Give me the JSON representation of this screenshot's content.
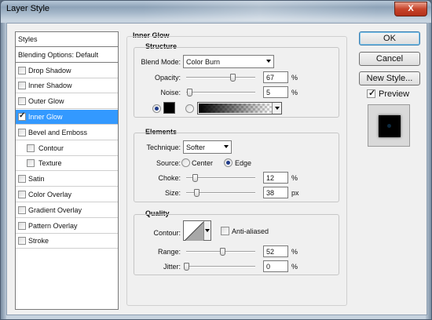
{
  "window": {
    "title": "Layer Style",
    "close_label": "X"
  },
  "sidebar": {
    "items": [
      {
        "label": "Styles",
        "header": true
      },
      {
        "label": "Blending Options: Default",
        "header": true
      },
      {
        "label": "Drop Shadow",
        "checked": false
      },
      {
        "label": "Inner Shadow",
        "checked": false
      },
      {
        "label": "Outer Glow",
        "checked": false
      },
      {
        "label": "Inner Glow",
        "checked": true,
        "selected": true
      },
      {
        "label": "Bevel and Emboss",
        "checked": false
      },
      {
        "label": "Contour",
        "checked": false,
        "sub": true
      },
      {
        "label": "Texture",
        "checked": false,
        "sub": true
      },
      {
        "label": "Satin",
        "checked": false
      },
      {
        "label": "Color Overlay",
        "checked": false
      },
      {
        "label": "Gradient Overlay",
        "checked": false
      },
      {
        "label": "Pattern Overlay",
        "checked": false
      },
      {
        "label": "Stroke",
        "checked": false
      }
    ]
  },
  "panel": {
    "title": "Inner Glow",
    "structure": {
      "title": "Structure",
      "blend_mode_label": "Blend Mode:",
      "blend_mode_value": "Color Burn",
      "opacity_label": "Opacity:",
      "opacity_value": "67",
      "opacity_unit": "%",
      "opacity_level": 0.67,
      "noise_label": "Noise:",
      "noise_value": "5",
      "noise_unit": "%",
      "noise_level": 0.05,
      "fill_mode": "color",
      "glow_color": "#000000"
    },
    "elements": {
      "title": "Elements",
      "technique_label": "Technique:",
      "technique_value": "Softer",
      "source_label": "Source:",
      "source_center_label": "Center",
      "source_edge_label": "Edge",
      "source_selected": "Edge",
      "choke_label": "Choke:",
      "choke_value": "12",
      "choke_unit": "%",
      "choke_level": 0.12,
      "size_label": "Size:",
      "size_value": "38",
      "size_unit": "px",
      "size_level": 0.15
    },
    "quality": {
      "title": "Quality",
      "contour_label": "Contour:",
      "antialiased_label": "Anti-aliased",
      "antialiased_checked": false,
      "range_label": "Range:",
      "range_value": "52",
      "range_unit": "%",
      "range_level": 0.52,
      "jitter_label": "Jitter:",
      "jitter_value": "0",
      "jitter_unit": "%",
      "jitter_level": 0.0
    }
  },
  "buttons": {
    "ok": "OK",
    "cancel": "Cancel",
    "new_style": "New Style..."
  },
  "preview": {
    "label": "Preview",
    "checked": true
  },
  "colors": {
    "selection": "#3399ff",
    "title_bar": "#a7b9cb",
    "client_bg": "#f0f0f0"
  }
}
